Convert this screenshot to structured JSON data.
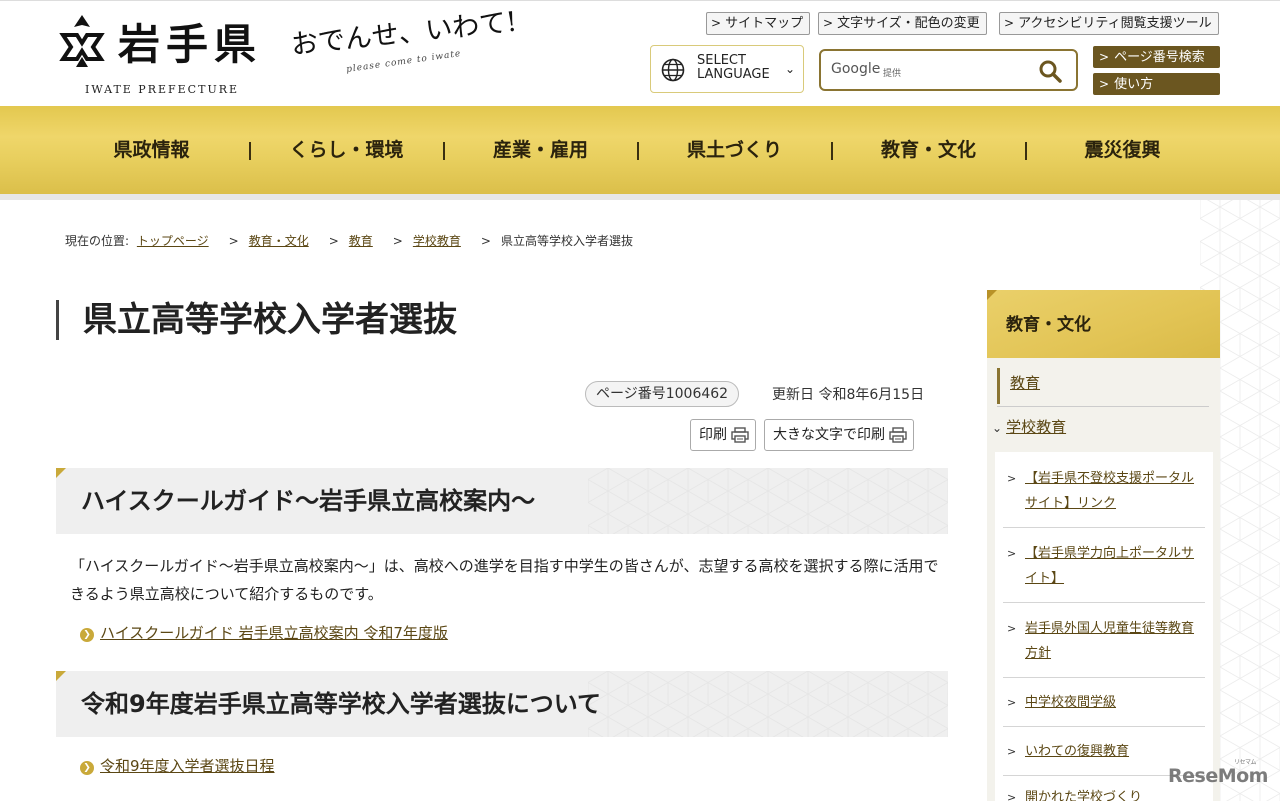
{
  "header": {
    "logo_text": "岩手県",
    "logo_sub": "IWATE PREFECTURE",
    "slogan": "おでんせ、いわて!",
    "slogan_sub": "please come to iwate",
    "util_links": [
      "サイトマップ",
      "文字サイズ・配色の変更",
      "アクセシビリティ閲覧支援ツール"
    ],
    "language": {
      "line1": "SELECT",
      "line2": "LANGUAGE"
    },
    "search": {
      "brand": "Google",
      "brand_sub": "提供",
      "placeholder": ""
    },
    "side_buttons": [
      "ページ番号検索",
      "使い方"
    ]
  },
  "gnav": [
    "県政情報",
    "くらし・環境",
    "産業・雇用",
    "県土づくり",
    "教育・文化",
    "震災復興"
  ],
  "breadcrumb": {
    "label": "現在の位置:",
    "links": [
      "トップページ",
      "教育・文化",
      "教育",
      "学校教育"
    ],
    "current": "県立高等学校入学者選抜"
  },
  "main": {
    "title": "県立高等学校入学者選抜",
    "page_number": "ページ番号1006462",
    "updated": "更新日 令和8年6月15日",
    "print_label": "印刷",
    "print_large_label": "大きな文字で印刷",
    "sections": [
      {
        "heading": "ハイスクールガイド〜岩手県立高校案内〜",
        "body": "「ハイスクールガイド〜岩手県立高校案内〜」は、高校への進学を目指す中学生の皆さんが、志望する高校を選択する際に活用できるよう県立高校について紹介するものです。",
        "link": "ハイスクールガイド 岩手県立高校案内 令和7年度版"
      },
      {
        "heading": "令和9年度岩手県立高等学校入学者選抜について",
        "link": "令和9年度入学者選抜日程"
      }
    ]
  },
  "side": {
    "heading": "教育・文化",
    "level1": "教育",
    "level2": "学校教育",
    "items": [
      "【岩手県不登校支援ポータルサイト】リンク",
      "【岩手県学力向上ポータルサイト】",
      "岩手県外国人児童生徒等教育方針",
      "中学校夜間学級",
      "いわての復興教育",
      "開かれた学校づくり"
    ]
  },
  "watermark": {
    "text": "ReseMom",
    "sub": "リセマム"
  },
  "colors": {
    "gold": "#e3c84f",
    "dark_gold": "#6b5620",
    "link": "#5b4714"
  }
}
